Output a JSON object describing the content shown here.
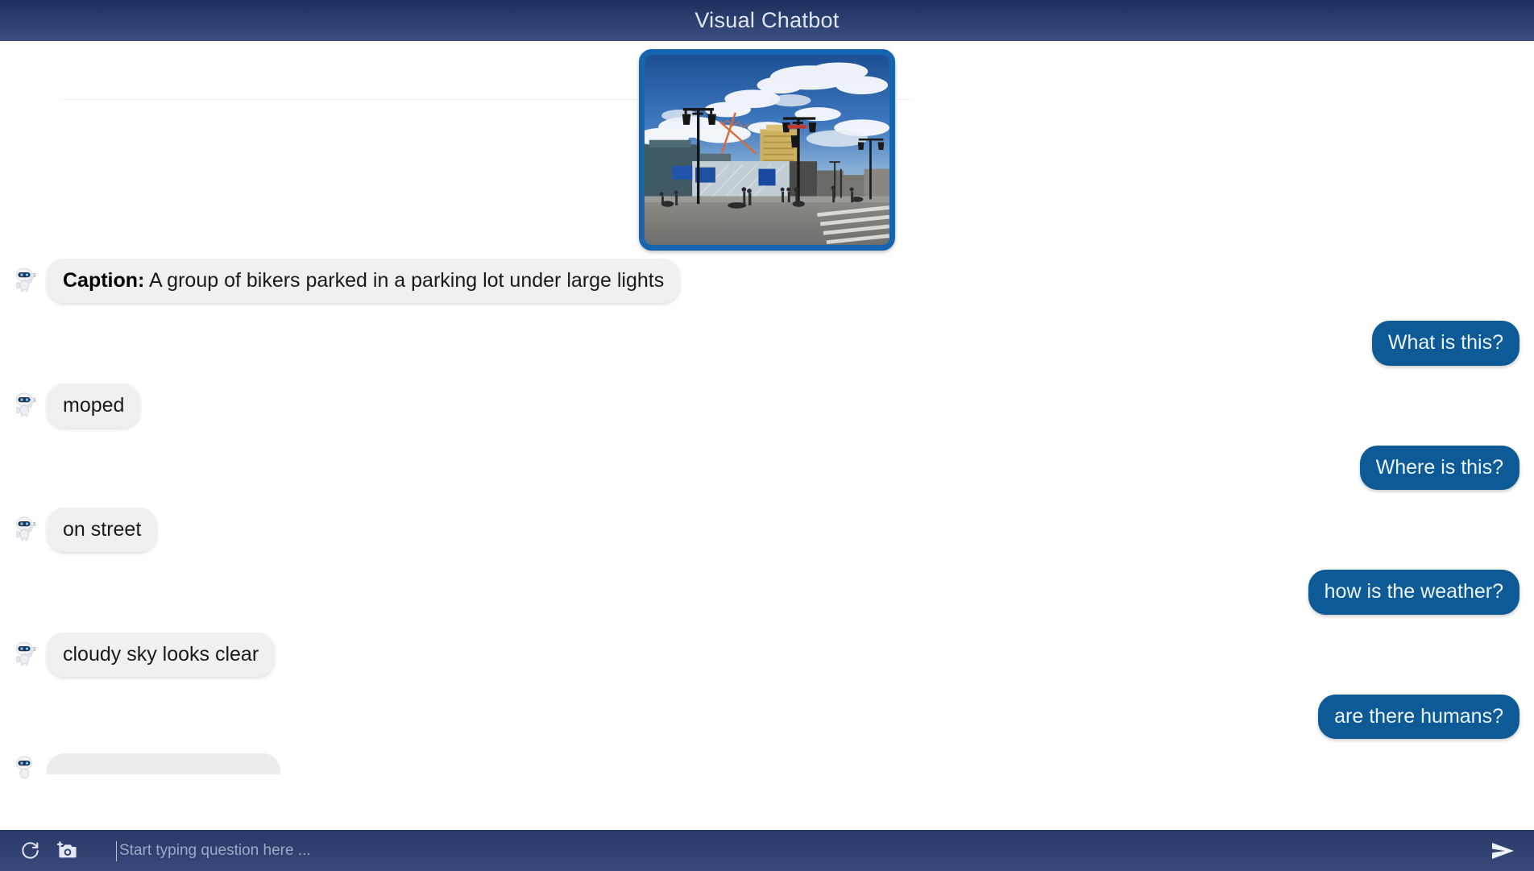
{
  "header": {
    "title": "Visual Chatbot"
  },
  "image": {
    "alt_description": "City street scene with blue cloudy sky, ornate double street lamps, a red construction crane, buildings under construction, parked mopeds and pedestrians on a plaza with a crosswalk",
    "border_color": "#1565b0"
  },
  "colors": {
    "header_dark": "#1d2f5c",
    "header_light": "#3b4f80",
    "user_bubble": "#0e5a96",
    "bot_bubble": "#f0f0f0",
    "accent_border": "#1565b0"
  },
  "conversation": [
    {
      "role": "bot",
      "label": "Caption:",
      "text": " A group of bikers parked in a parking lot under large lights",
      "avatar": "robot-avatar-icon"
    },
    {
      "role": "user",
      "text": "What is this?"
    },
    {
      "role": "bot",
      "text": "moped",
      "avatar": "robot-avatar-icon"
    },
    {
      "role": "user",
      "text": "Where is this?"
    },
    {
      "role": "bot",
      "text": "on street",
      "avatar": "robot-avatar-icon"
    },
    {
      "role": "user",
      "text": "how is the weather?"
    },
    {
      "role": "bot",
      "text": "cloudy sky looks clear",
      "avatar": "robot-avatar-icon"
    },
    {
      "role": "user",
      "text": "are there humans?"
    }
  ],
  "footer": {
    "refresh_icon": "refresh-icon",
    "camera_icon": "add-photo-icon",
    "send_icon": "send-icon",
    "input_value": "",
    "input_placeholder": "Start typing question here ..."
  }
}
